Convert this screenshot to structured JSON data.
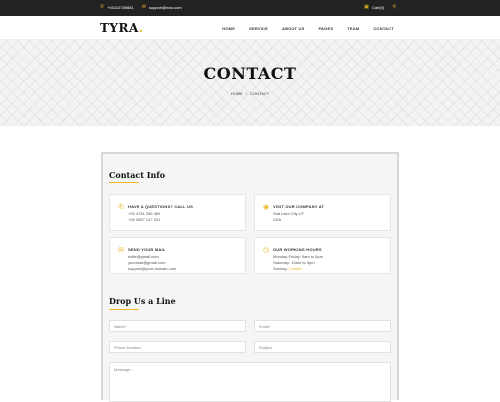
{
  "topbar": {
    "phone": "+00112789881",
    "email": "support@edu.com",
    "cart": "Cart(0)",
    "icons": {
      "phone": "phone-icon",
      "email": "envelope-icon",
      "cart": "cart-icon",
      "search": "search-icon"
    }
  },
  "nav": {
    "logo": "TYRA",
    "logo_dot": ".",
    "items": [
      "HOME",
      "SERVICE",
      "ABOUT US",
      "PAGES",
      "TEAM",
      "CONTACT"
    ]
  },
  "hero": {
    "title": "CONTACT",
    "breadcrumb": {
      "home": "HOME",
      "separator": "/",
      "current": "CONTACT"
    }
  },
  "contact_info": {
    "title": "Contact Info",
    "cards": [
      {
        "icon": "phone-icon",
        "title": "HAVE A QUESTIONS? CALL US",
        "lines": [
          "+00 4781 256 369",
          "+00 0667 147 251"
        ]
      },
      {
        "icon": "location-icon",
        "title": "VISIT OUR COMPANY AT",
        "lines": [
          "Salt Lake City UT",
          "USA"
        ]
      },
      {
        "icon": "envelope-icon",
        "title": "SEND YOUR MAIL",
        "lines": [
          "ezlfe@gmail.com",
          "yourmail@gmail.com",
          "support@your-domain.com"
        ]
      },
      {
        "icon": "clock-icon",
        "title": "OUR WORKING HOURS",
        "lines": [
          "Monday-Friday: 9am to 5pm",
          "Saturday: 10am to 3pm"
        ],
        "sunday_label": "Sunday:",
        "sunday_value": "Closed"
      }
    ]
  },
  "form": {
    "title": "Drop Us a Line",
    "name_placeholder": "Name*",
    "email_placeholder": "Email*",
    "phone_placeholder": "Phone Number",
    "subject_placeholder": "Subject",
    "message_placeholder": "Message..."
  },
  "colors": {
    "accent": "#f1b527",
    "topbar": "#222222"
  }
}
